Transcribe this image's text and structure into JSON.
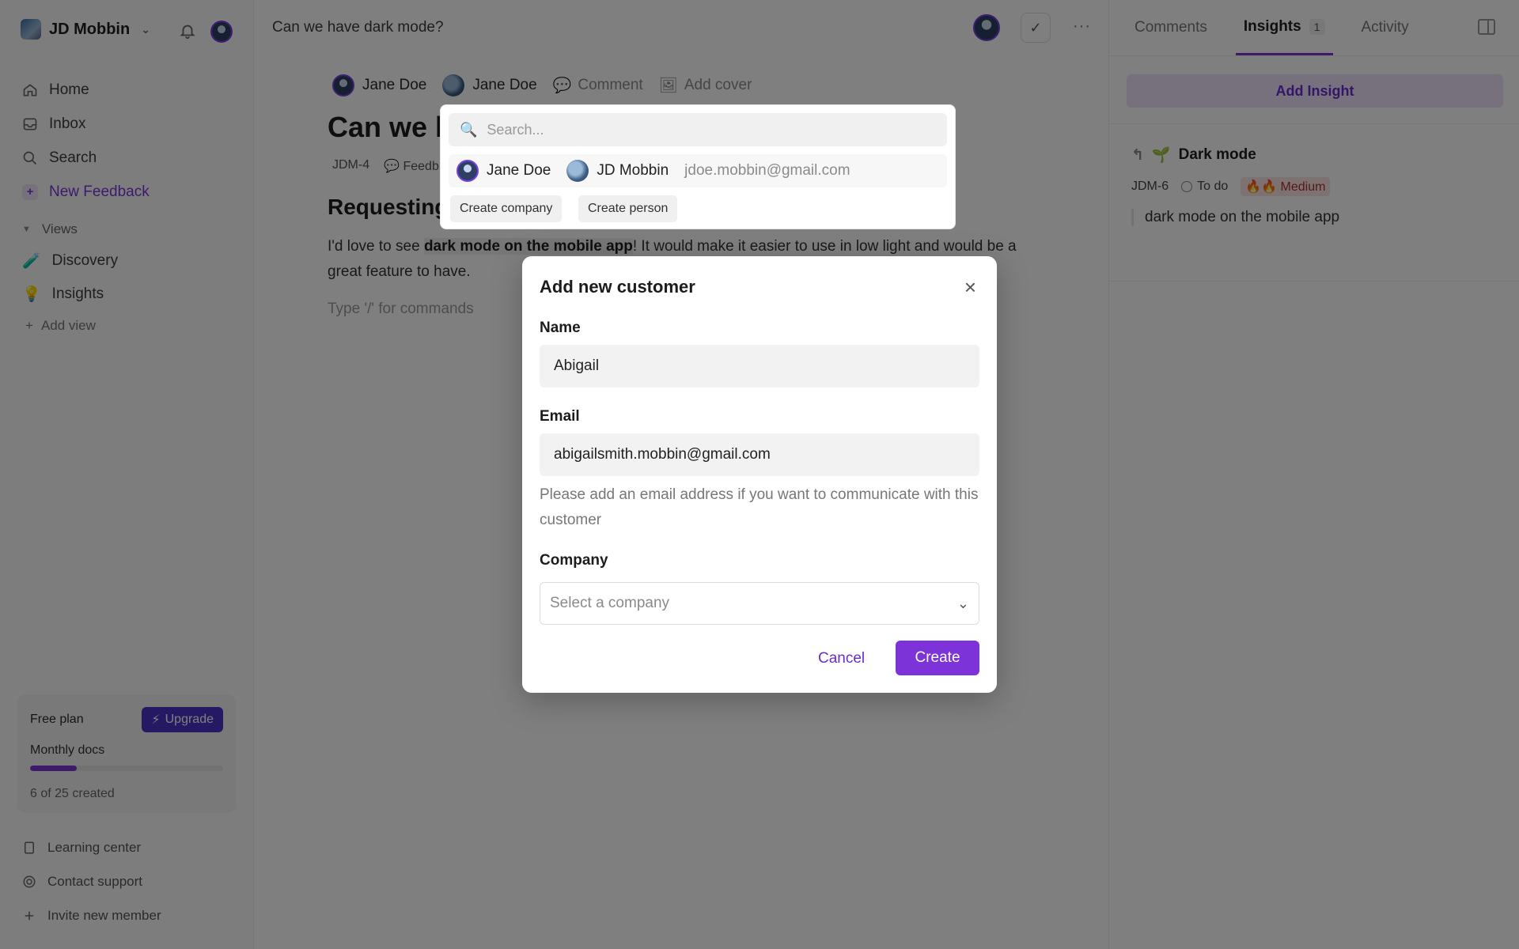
{
  "sidebar": {
    "workspace_name": "JD Mobbin",
    "nav": [
      {
        "label": "Home",
        "icon": "home-icon"
      },
      {
        "label": "Inbox",
        "icon": "inbox-icon"
      },
      {
        "label": "Search",
        "icon": "search-icon"
      },
      {
        "label": "New Feedback",
        "icon": "plus-icon"
      }
    ],
    "views_header": "Views",
    "views": [
      {
        "label": "Discovery",
        "icon": "beaker-icon",
        "glyph": "🧪"
      },
      {
        "label": "Insights",
        "icon": "lightbulb-icon",
        "glyph": "💡"
      }
    ],
    "add_view": "Add view",
    "plan": {
      "name": "Free plan",
      "upgrade_label": "Upgrade",
      "metric": "Monthly docs",
      "used": 6,
      "limit": 25,
      "count_text": "6 of 25 created"
    },
    "bottom_links": [
      {
        "label": "Learning center",
        "icon": "book-icon"
      },
      {
        "label": "Contact support",
        "icon": "support-icon"
      },
      {
        "label": "Invite new member",
        "icon": "plus-icon"
      }
    ]
  },
  "main": {
    "breadcrumb_title": "Can we have dark mode?",
    "meta": {
      "person1": "Jane Doe",
      "person2": "Jane Doe",
      "comment": "Comment",
      "add_cover": "Add cover"
    },
    "title": "Can we h",
    "id": "JDM-4",
    "type": "Feedb",
    "subheading": "Requesting",
    "para_before": "I'd love to see ",
    "para_bold": "dark mode on the mobile app",
    "para_after": "! It would make it easier to use in low light and would be a great feature to have.",
    "hint": "Type '/' for commands"
  },
  "right": {
    "tabs": [
      {
        "label": "Comments"
      },
      {
        "label": "Insights",
        "count": "1"
      },
      {
        "label": "Activity"
      }
    ],
    "add_insight": "Add Insight",
    "insight": {
      "title": "Dark mode",
      "id": "JDM-6",
      "status": "To do",
      "priority": "🔥🔥 Medium",
      "quote": "dark mode on the mobile app"
    }
  },
  "dropdown": {
    "search_placeholder": "Search...",
    "option1": "Jane Doe",
    "option2": "JD Mobbin",
    "option_email": "jdoe.mobbin@gmail.com",
    "create_company": "Create company",
    "create_person": "Create person"
  },
  "modal": {
    "title": "Add new customer",
    "name_label": "Name",
    "name_value": "Abigail",
    "email_label": "Email",
    "email_value": "abigailsmith.mobbin@gmail.com",
    "email_help": "Please add an email address if you want to communicate with this customer",
    "company_label": "Company",
    "company_placeholder": "Select a company",
    "cancel": "Cancel",
    "create": "Create"
  },
  "colors": {
    "accent": "#7c34d8",
    "upgrade": "#4a33c9"
  }
}
